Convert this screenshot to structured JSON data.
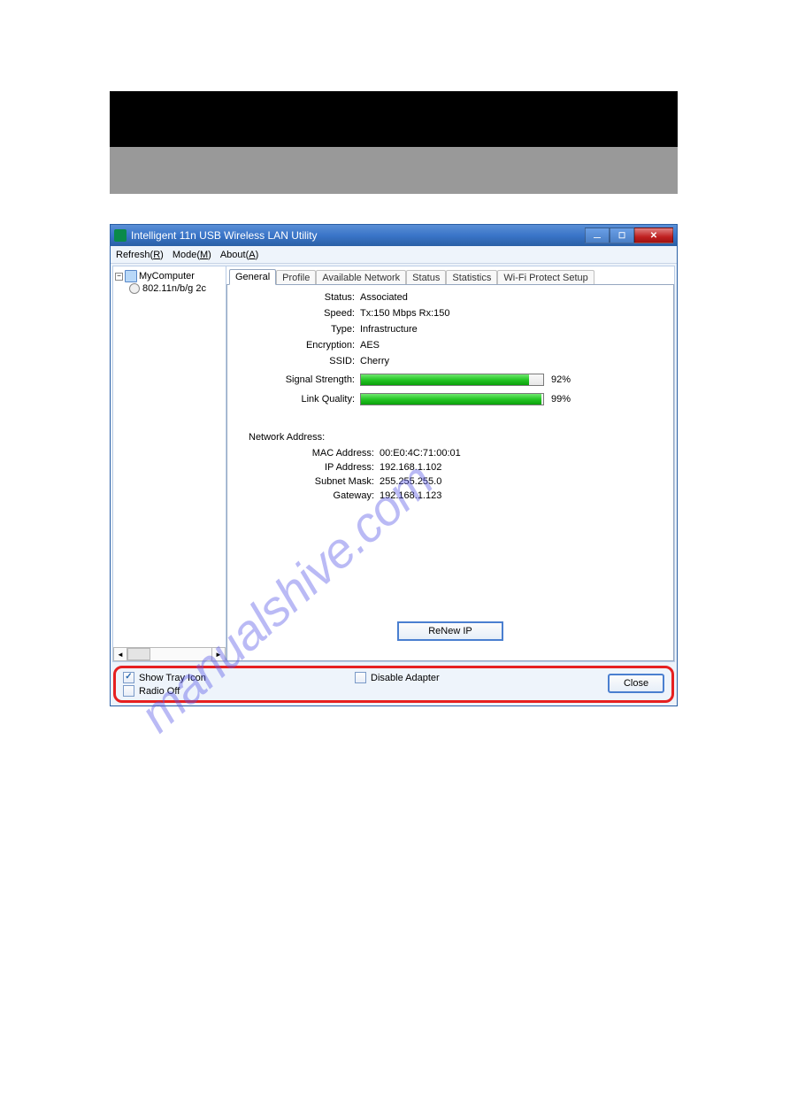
{
  "watermark_text": "manualshive.com",
  "window": {
    "title": "Intelligent 11n USB Wireless LAN Utility"
  },
  "menu": {
    "refresh": "Refresh(R)",
    "mode": "Mode(M)",
    "about": "About(A)"
  },
  "tree": {
    "root": "MyComputer",
    "adapter": "802.11n/b/g 2c"
  },
  "tabs": [
    "General",
    "Profile",
    "Available Network",
    "Status",
    "Statistics",
    "Wi-Fi Protect Setup"
  ],
  "status": {
    "status_label": "Status:",
    "status_value": "Associated",
    "speed_label": "Speed:",
    "speed_value": "Tx:150 Mbps Rx:150",
    "type_label": "Type:",
    "type_value": "Infrastructure",
    "enc_label": "Encryption:",
    "enc_value": "AES",
    "ssid_label": "SSID:",
    "ssid_value": "Cherry",
    "signal_label": "Signal Strength:",
    "signal_pct": "92%",
    "link_label": "Link Quality:",
    "link_pct": "99%"
  },
  "net": {
    "heading": "Network Address:",
    "mac_label": "MAC Address:",
    "mac_value": "00:E0:4C:71:00:01",
    "ip_label": "IP Address:",
    "ip_value": "192.168.1.102",
    "mask_label": "Subnet Mask:",
    "mask_value": "255.255.255.0",
    "gw_label": "Gateway:",
    "gw_value": "192.168.1.123",
    "renew_btn": "ReNew IP"
  },
  "bottom": {
    "show_tray": "Show Tray Icon",
    "radio_off": "Radio Off",
    "disable_adapter": "Disable Adapter",
    "close": "Close"
  }
}
